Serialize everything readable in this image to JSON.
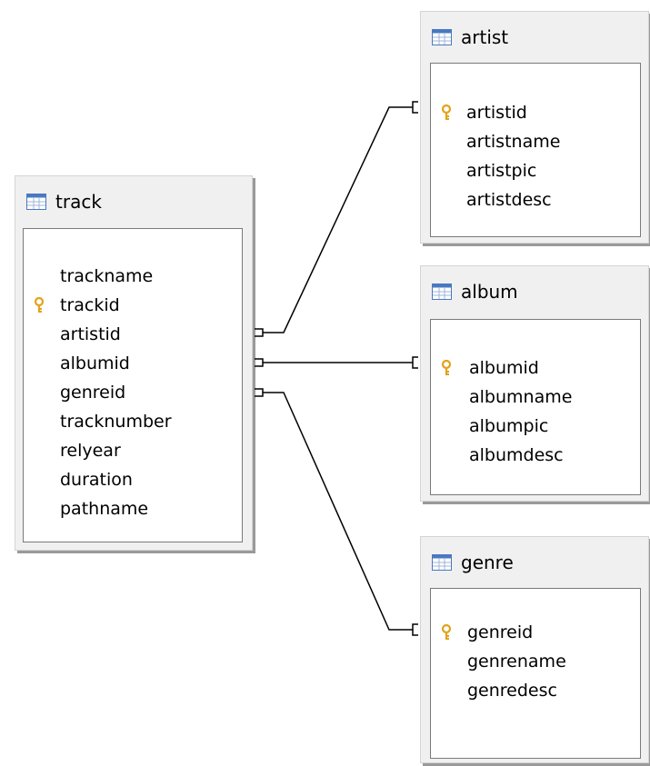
{
  "tables": {
    "track": {
      "name": "track",
      "fields": [
        {
          "name": "trackname",
          "pk": false
        },
        {
          "name": "trackid",
          "pk": true
        },
        {
          "name": "artistid",
          "pk": false
        },
        {
          "name": "albumid",
          "pk": false
        },
        {
          "name": "genreid",
          "pk": false
        },
        {
          "name": "tracknumber",
          "pk": false
        },
        {
          "name": "relyear",
          "pk": false
        },
        {
          "name": "duration",
          "pk": false
        },
        {
          "name": "pathname",
          "pk": false
        }
      ]
    },
    "artist": {
      "name": "artist",
      "fields": [
        {
          "name": "artistid",
          "pk": true
        },
        {
          "name": "artistname",
          "pk": false
        },
        {
          "name": "artistpic",
          "pk": false
        },
        {
          "name": "artistdesc",
          "pk": false
        }
      ]
    },
    "album": {
      "name": "album",
      "fields": [
        {
          "name": "albumid",
          "pk": true
        },
        {
          "name": "albumname",
          "pk": false
        },
        {
          "name": "albumpic",
          "pk": false
        },
        {
          "name": "albumdesc",
          "pk": false
        }
      ]
    },
    "genre": {
      "name": "genre",
      "fields": [
        {
          "name": "genreid",
          "pk": true
        },
        {
          "name": "genrename",
          "pk": false
        },
        {
          "name": "genredesc",
          "pk": false
        }
      ]
    }
  },
  "relations": [
    {
      "from_table": "track",
      "from_field": "artistid",
      "to_table": "artist",
      "to_field": "artistid"
    },
    {
      "from_table": "track",
      "from_field": "albumid",
      "to_table": "album",
      "to_field": "albumid"
    },
    {
      "from_table": "track",
      "from_field": "genreid",
      "to_table": "genre",
      "to_field": "genreid"
    }
  ],
  "colors": {
    "title_bar": "#f0f0f0",
    "field_area": "#ffffff",
    "key_icon": "#e3a21a",
    "table_icon": "#4a78c2",
    "connector": "#000000"
  }
}
